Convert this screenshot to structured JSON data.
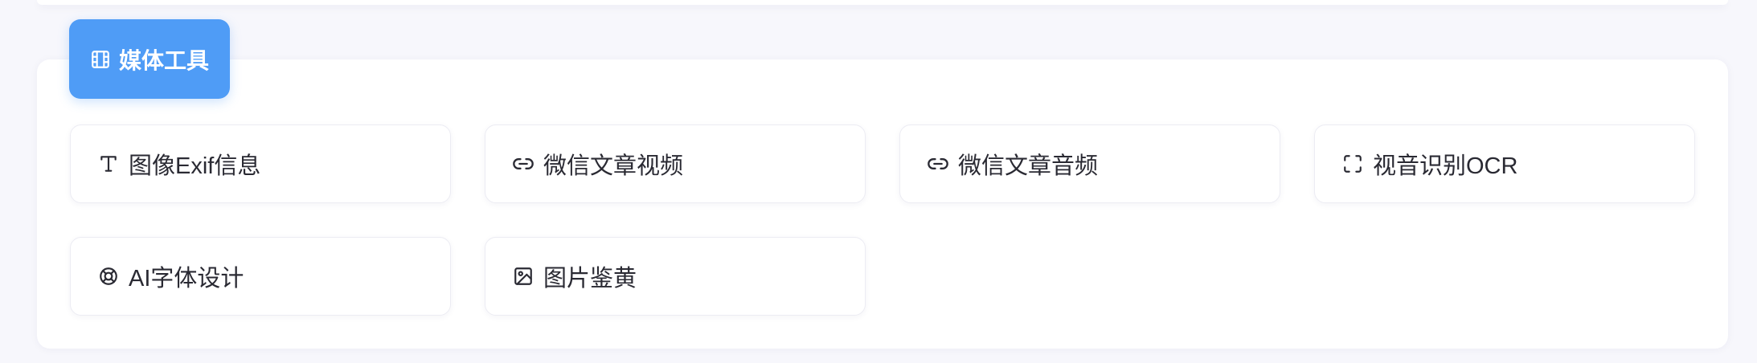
{
  "section": {
    "title": "媒体工具",
    "icon": "film-icon",
    "accent_color": "#4f9cf6"
  },
  "tools": [
    {
      "label": "图像Exif信息",
      "icon": "text-icon"
    },
    {
      "label": "微信文章视频",
      "icon": "link-icon"
    },
    {
      "label": "微信文章音频",
      "icon": "link-icon"
    },
    {
      "label": "视音识别OCR",
      "icon": "scan-icon"
    },
    {
      "label": "AI字体设计",
      "icon": "lifebuoy-icon"
    },
    {
      "label": "图片鉴黄",
      "icon": "image-icon"
    }
  ]
}
